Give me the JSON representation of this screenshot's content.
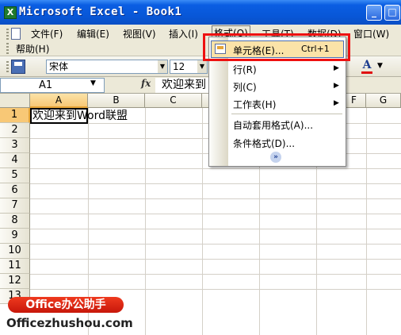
{
  "window": {
    "title": "Microsoft Excel - Book1",
    "icon": "excel-icon",
    "buttons": [
      "_",
      "□"
    ]
  },
  "menubar": {
    "items": [
      {
        "label": "文件(F)"
      },
      {
        "label": "编辑(E)"
      },
      {
        "label": "视图(V)"
      },
      {
        "label": "插入(I)"
      },
      {
        "label": "格式(O)"
      },
      {
        "label": "工具(T)"
      },
      {
        "label": "数据(D)"
      },
      {
        "label": "窗口(W)"
      }
    ],
    "help": "帮助(H)"
  },
  "toolbar": {
    "font_name": "宋体",
    "font_size": "12",
    "font_color_label": "A",
    "colors": {
      "font_color": "#e01010"
    }
  },
  "formula_bar": {
    "name_box": "A1",
    "fx": "fx",
    "value": "欢迎来到"
  },
  "grid": {
    "columns": [
      "A",
      "B",
      "C",
      "F",
      "G"
    ],
    "rows": [
      "1",
      "2",
      "3",
      "4",
      "5",
      "6",
      "7",
      "8",
      "9",
      "10",
      "11",
      "12",
      "13"
    ],
    "cell_a1": "欢迎来到Word联盟"
  },
  "format_menu": {
    "items": [
      {
        "label": "单元格(E)...",
        "shortcut": "Ctrl+1"
      },
      {
        "label": "行(R)"
      },
      {
        "label": "列(C)"
      },
      {
        "label": "工作表(H)"
      },
      {
        "label": "自动套用格式(A)..."
      },
      {
        "label": "条件格式(D)..."
      }
    ],
    "expand": "»"
  },
  "watermark": {
    "badge": "Office办公助手",
    "url": "Officezhushou.com"
  },
  "colors": {
    "titlebar": "#0856d6",
    "highlight_box": "#e11111",
    "selection": "#f8c876"
  }
}
